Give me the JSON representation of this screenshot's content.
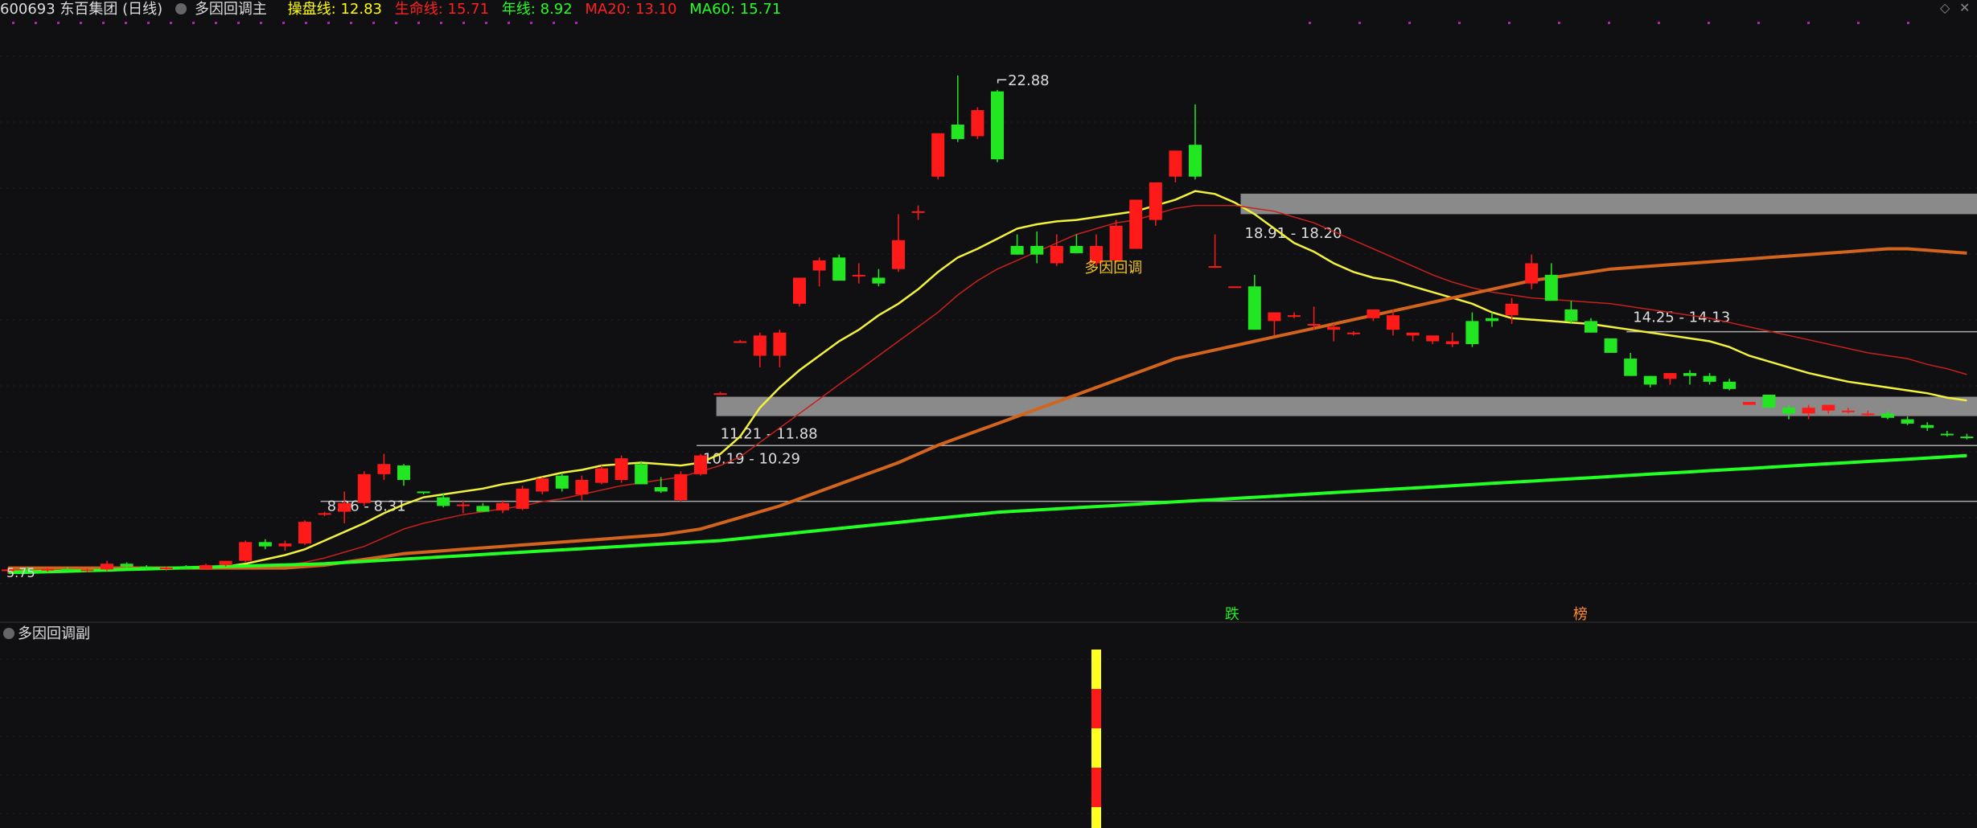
{
  "header": {
    "code_name": "600693 东百集团 (日线)",
    "indicator_name": "多因回调主",
    "items": [
      {
        "label": "操盘线: 12.83",
        "color": "#ffff00"
      },
      {
        "label": "生命线: 15.71",
        "color": "#ff2020"
      },
      {
        "label": "年线: 8.92",
        "color": "#22ff22"
      },
      {
        "label": "MA20: 13.10",
        "color": "#ff2020"
      },
      {
        "label": "MA60: 15.71",
        "color": "#22ff22"
      }
    ]
  },
  "sub_panel": {
    "title": "多因回调副"
  },
  "colors": {
    "background": "#101012",
    "up": "#ff1a1a",
    "down": "#22e622",
    "yellow": "#f2f23a",
    "ma_red": "#c8201c",
    "orange": "#d2641e",
    "green_line": "#22ff22",
    "zone": "#a0a0a0"
  },
  "chart_data": {
    "type": "candlestick",
    "ylim": [
      5.3,
      24.5
    ],
    "candles": [
      [
        5.85,
        5.95,
        5.75,
        5.9
      ],
      [
        5.9,
        6.0,
        5.8,
        5.88
      ],
      [
        5.88,
        5.95,
        5.82,
        5.92
      ],
      [
        5.92,
        5.98,
        5.85,
        5.87
      ],
      [
        5.87,
        5.94,
        5.8,
        5.9
      ],
      [
        5.9,
        6.2,
        5.85,
        6.1
      ],
      [
        6.1,
        6.15,
        5.95,
        6.0
      ],
      [
        6.0,
        6.05,
        5.9,
        5.95
      ],
      [
        5.95,
        6.0,
        5.85,
        5.97
      ],
      [
        5.97,
        6.05,
        5.9,
        5.92
      ],
      [
        5.92,
        6.1,
        5.88,
        6.05
      ],
      [
        6.05,
        6.2,
        6.0,
        6.2
      ],
      [
        6.2,
        6.9,
        6.15,
        6.85
      ],
      [
        6.85,
        6.95,
        6.6,
        6.7
      ],
      [
        6.7,
        6.9,
        6.55,
        6.8
      ],
      [
        6.8,
        7.6,
        6.75,
        7.55
      ],
      [
        7.8,
        7.9,
        7.75,
        7.85
      ],
      [
        7.9,
        8.6,
        7.5,
        8.2
      ],
      [
        8.2,
        9.3,
        8.1,
        9.2
      ],
      [
        9.2,
        9.9,
        9.0,
        9.55
      ],
      [
        9.5,
        9.55,
        8.8,
        9.0
      ],
      [
        8.6,
        8.6,
        8.5,
        8.55
      ],
      [
        8.4,
        8.55,
        8.05,
        8.1
      ],
      [
        8.1,
        8.3,
        7.85,
        8.15
      ],
      [
        8.1,
        8.2,
        7.9,
        7.9
      ],
      [
        7.95,
        8.3,
        7.85,
        8.2
      ],
      [
        8.0,
        8.8,
        7.95,
        8.7
      ],
      [
        8.6,
        9.1,
        8.5,
        9.05
      ],
      [
        9.15,
        9.25,
        8.6,
        8.7
      ],
      [
        8.5,
        9.15,
        8.3,
        9.0
      ],
      [
        8.9,
        9.5,
        8.85,
        9.4
      ],
      [
        9.0,
        9.85,
        8.9,
        9.75
      ],
      [
        9.55,
        9.65,
        8.85,
        8.85
      ],
      [
        8.75,
        9.1,
        8.55,
        8.6
      ],
      [
        8.3,
        9.3,
        8.25,
        9.2
      ],
      [
        9.2,
        9.9,
        9.15,
        9.85
      ],
      [
        12.0,
        12.05,
        12.0,
        12.0
      ],
      [
        13.8,
        13.85,
        13.8,
        13.8
      ],
      [
        13.3,
        14.1,
        12.9,
        14.0
      ],
      [
        13.3,
        14.2,
        12.9,
        14.1
      ],
      [
        15.1,
        16.0,
        15.0,
        16.0
      ],
      [
        16.25,
        16.7,
        15.7,
        16.6
      ],
      [
        16.7,
        16.8,
        15.9,
        15.9
      ],
      [
        16.1,
        16.5,
        15.8,
        16.1
      ],
      [
        16.0,
        16.3,
        15.7,
        15.8
      ],
      [
        16.3,
        18.2,
        16.2,
        17.3
      ],
      [
        18.3,
        18.5,
        18.0,
        18.3
      ],
      [
        19.5,
        21.0,
        19.4,
        21.0
      ],
      [
        21.3,
        23.0,
        20.7,
        20.8
      ],
      [
        20.9,
        21.9,
        20.8,
        21.8
      ],
      [
        22.45,
        22.5,
        20.0,
        20.1
      ],
      [
        17.1,
        17.5,
        16.8,
        16.8
      ],
      [
        17.1,
        17.6,
        16.5,
        16.8
      ],
      [
        16.5,
        17.5,
        16.4,
        17.1
      ],
      [
        17.1,
        17.5,
        16.9,
        16.85
      ],
      [
        16.5,
        17.5,
        16.4,
        17.1
      ],
      [
        16.6,
        18.0,
        16.5,
        17.8
      ],
      [
        17.0,
        18.4,
        17.0,
        18.7
      ],
      [
        18.0,
        18.8,
        17.8,
        19.3
      ],
      [
        19.5,
        20.1,
        19.3,
        20.4
      ],
      [
        20.6,
        22.0,
        19.4,
        19.5
      ],
      [
        16.4,
        17.5,
        16.4,
        16.4
      ],
      [
        15.7,
        15.7,
        15.7,
        15.7
      ],
      [
        15.7,
        16.1,
        14.2,
        14.2
      ],
      [
        14.5,
        14.7,
        14.0,
        14.8
      ],
      [
        14.7,
        14.8,
        14.6,
        14.7
      ],
      [
        14.4,
        15.0,
        14.2,
        14.4
      ],
      [
        14.2,
        14.4,
        13.8,
        14.3
      ],
      [
        14.05,
        14.15,
        14.0,
        14.1
      ],
      [
        14.6,
        14.8,
        14.5,
        14.9
      ],
      [
        14.2,
        14.9,
        14.0,
        14.7
      ],
      [
        14.0,
        14.1,
        13.8,
        14.1
      ],
      [
        13.8,
        14.0,
        13.7,
        14.0
      ],
      [
        13.7,
        14.1,
        13.6,
        13.8
      ],
      [
        14.5,
        14.8,
        13.6,
        13.7
      ],
      [
        14.6,
        14.8,
        14.3,
        14.5
      ],
      [
        14.7,
        15.3,
        14.4,
        15.1
      ],
      [
        15.8,
        16.8,
        15.6,
        16.5
      ],
      [
        16.1,
        16.5,
        15.3,
        15.2
      ],
      [
        14.9,
        15.2,
        14.4,
        14.5
      ],
      [
        14.5,
        14.6,
        14.1,
        14.1
      ],
      [
        13.9,
        13.9,
        13.4,
        13.4
      ],
      [
        13.2,
        13.4,
        12.6,
        12.6
      ],
      [
        12.6,
        12.6,
        12.2,
        12.3
      ],
      [
        12.5,
        12.7,
        12.3,
        12.7
      ],
      [
        12.7,
        12.8,
        12.3,
        12.6
      ],
      [
        12.6,
        12.7,
        12.3,
        12.4
      ],
      [
        12.4,
        12.5,
        12.1,
        12.15
      ],
      [
        11.6,
        11.7,
        11.6,
        11.7
      ],
      [
        11.95,
        11.5,
        11.5,
        11.5
      ],
      [
        11.5,
        11.6,
        11.1,
        11.3
      ],
      [
        11.3,
        11.6,
        11.1,
        11.5
      ],
      [
        11.4,
        11.5,
        11.3,
        11.6
      ],
      [
        11.35,
        11.5,
        11.3,
        11.4
      ],
      [
        11.3,
        11.4,
        11.2,
        11.3
      ],
      [
        11.3,
        11.4,
        11.1,
        11.15
      ],
      [
        11.1,
        11.2,
        10.9,
        10.95
      ],
      [
        10.9,
        11.0,
        10.7,
        10.8
      ],
      [
        10.6,
        10.7,
        10.5,
        10.55
      ],
      [
        10.5,
        10.6,
        10.4,
        10.45
      ]
    ],
    "price_labels": [
      "22.88",
      "5.75"
    ],
    "zones": [
      {
        "label": "18.91 - 18.20",
        "lo": 18.2,
        "hi": 18.91,
        "style": "band"
      },
      {
        "label": "11.21 - 11.88",
        "lo": 11.21,
        "hi": 11.88,
        "style": "band"
      },
      {
        "label": "14.25 - 14.13",
        "lo": 14.13,
        "hi": 14.25,
        "style": "line"
      },
      {
        "label": "10.19 - 10.29",
        "lo": 10.19,
        "hi": 10.29,
        "style": "line"
      },
      {
        "label": "8.26 - 8.31",
        "lo": 8.26,
        "hi": 8.31,
        "style": "line"
      }
    ],
    "annotations": [
      {
        "text": "多因回调",
        "color": "#f0c020"
      },
      {
        "text": "跌",
        "color": "#22ee22"
      },
      {
        "text": "榜",
        "color": "#ff8c2a"
      }
    ],
    "lines": [
      {
        "key": "yellow",
        "color": "#f2f23a",
        "values": [
          5.9,
          5.9,
          5.9,
          5.9,
          5.9,
          5.9,
          5.95,
          5.95,
          5.95,
          5.95,
          5.95,
          6.0,
          6.1,
          6.25,
          6.4,
          6.6,
          6.9,
          7.2,
          7.5,
          7.85,
          8.15,
          8.4,
          8.5,
          8.6,
          8.7,
          8.85,
          8.95,
          9.1,
          9.25,
          9.35,
          9.5,
          9.55,
          9.6,
          9.55,
          9.5,
          9.6,
          9.9,
          10.5,
          11.5,
          12.2,
          12.8,
          13.3,
          13.8,
          14.2,
          14.7,
          15.1,
          15.6,
          16.2,
          16.7,
          17.0,
          17.35,
          17.7,
          17.85,
          17.95,
          18.0,
          18.1,
          18.2,
          18.3,
          18.5,
          18.7,
          19.0,
          18.9,
          18.6,
          18.2,
          17.7,
          17.2,
          16.9,
          16.5,
          16.2,
          16.0,
          15.9,
          15.7,
          15.5,
          15.3,
          15.1,
          14.8,
          14.6,
          14.55,
          14.5,
          14.45,
          14.4,
          14.3,
          14.2,
          14.1,
          14.0,
          13.9,
          13.8,
          13.6,
          13.3,
          13.1,
          12.9,
          12.7,
          12.55,
          12.4,
          12.3,
          12.2,
          12.1,
          12.0,
          11.85,
          11.75
        ]
      },
      {
        "key": "ma_red",
        "color": "#c8201c",
        "values": [
          5.9,
          5.9,
          5.9,
          5.9,
          5.9,
          5.9,
          5.9,
          5.95,
          5.95,
          5.95,
          5.95,
          5.95,
          5.95,
          6.0,
          6.05,
          6.15,
          6.3,
          6.5,
          6.7,
          7.0,
          7.3,
          7.5,
          7.65,
          7.8,
          7.9,
          8.0,
          8.1,
          8.25,
          8.35,
          8.5,
          8.65,
          8.8,
          8.9,
          9.0,
          9.1,
          9.3,
          9.5,
          9.8,
          10.3,
          10.8,
          11.3,
          11.8,
          12.3,
          12.8,
          13.3,
          13.8,
          14.3,
          14.8,
          15.4,
          15.9,
          16.3,
          16.6,
          16.9,
          17.2,
          17.5,
          17.7,
          17.9,
          18.0,
          18.2,
          18.4,
          18.5,
          18.5,
          18.5,
          18.4,
          18.3,
          18.1,
          17.9,
          17.6,
          17.3,
          17.0,
          16.7,
          16.4,
          16.1,
          15.85,
          15.65,
          15.5,
          15.4,
          15.3,
          15.25,
          15.2,
          15.15,
          15.1,
          15.0,
          14.9,
          14.8,
          14.7,
          14.6,
          14.45,
          14.3,
          14.15,
          14.0,
          13.85,
          13.7,
          13.55,
          13.4,
          13.3,
          13.2,
          13.0,
          12.85,
          12.65
        ]
      },
      {
        "key": "orange",
        "color": "#d2641e",
        "values": [
          5.95,
          5.95,
          5.95,
          5.95,
          5.95,
          5.95,
          5.95,
          5.95,
          5.95,
          5.95,
          5.95,
          5.95,
          5.95,
          5.95,
          5.95,
          6.0,
          6.05,
          6.15,
          6.25,
          6.35,
          6.45,
          6.5,
          6.55,
          6.6,
          6.65,
          6.7,
          6.75,
          6.8,
          6.85,
          6.9,
          6.95,
          7.0,
          7.05,
          7.1,
          7.2,
          7.3,
          7.5,
          7.7,
          7.9,
          8.1,
          8.35,
          8.6,
          8.85,
          9.1,
          9.35,
          9.6,
          9.9,
          10.2,
          10.45,
          10.7,
          10.95,
          11.2,
          11.45,
          11.7,
          11.95,
          12.2,
          12.45,
          12.7,
          12.95,
          13.2,
          13.35,
          13.5,
          13.65,
          13.8,
          13.95,
          14.1,
          14.25,
          14.4,
          14.55,
          14.7,
          14.85,
          15.0,
          15.15,
          15.3,
          15.45,
          15.6,
          15.75,
          15.9,
          16.0,
          16.1,
          16.2,
          16.3,
          16.35,
          16.4,
          16.45,
          16.5,
          16.55,
          16.6,
          16.65,
          16.7,
          16.75,
          16.8,
          16.85,
          16.9,
          16.95,
          17.0,
          17.0,
          16.95,
          16.9,
          16.85
        ]
      },
      {
        "key": "green_line",
        "color": "#22ff22",
        "values": [
          5.8,
          5.8,
          5.82,
          5.84,
          5.86,
          5.88,
          5.9,
          5.92,
          5.94,
          5.96,
          5.98,
          6.0,
          6.02,
          6.04,
          6.06,
          6.08,
          6.1,
          6.14,
          6.18,
          6.22,
          6.26,
          6.3,
          6.34,
          6.38,
          6.42,
          6.46,
          6.5,
          6.54,
          6.58,
          6.62,
          6.66,
          6.7,
          6.74,
          6.78,
          6.82,
          6.86,
          6.9,
          6.97,
          7.04,
          7.11,
          7.18,
          7.25,
          7.32,
          7.39,
          7.46,
          7.53,
          7.6,
          7.67,
          7.74,
          7.81,
          7.88,
          7.92,
          7.96,
          8.0,
          8.04,
          8.08,
          8.12,
          8.16,
          8.2,
          8.24,
          8.28,
          8.32,
          8.36,
          8.4,
          8.44,
          8.48,
          8.52,
          8.56,
          8.6,
          8.64,
          8.68,
          8.72,
          8.76,
          8.8,
          8.84,
          8.88,
          8.92,
          8.96,
          9.0,
          9.04,
          9.08,
          9.12,
          9.16,
          9.2,
          9.24,
          9.28,
          9.32,
          9.36,
          9.4,
          9.44,
          9.48,
          9.52,
          9.56,
          9.6,
          9.64,
          9.68,
          9.72,
          9.76,
          9.8,
          9.84
        ]
      }
    ],
    "sub_bar": {
      "label": "多因回调副",
      "segments": [
        "#ffff20",
        "#ff1a1a",
        "#ffff20",
        "#ff1a1a",
        "#ffff20"
      ]
    }
  }
}
